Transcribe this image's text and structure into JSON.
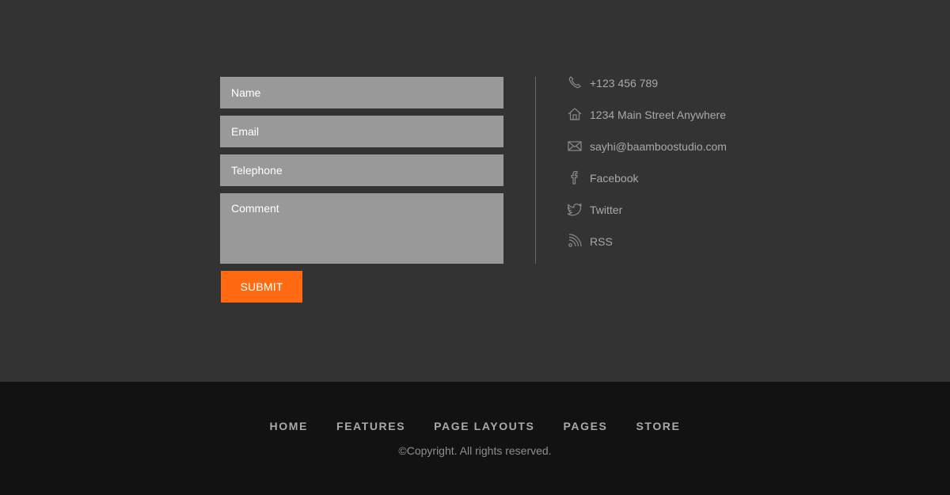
{
  "form": {
    "name_placeholder": "Name",
    "email_placeholder": "Email",
    "telephone_placeholder": "Telephone",
    "comment_placeholder": "Comment",
    "submit_label": "SUBMIT"
  },
  "contact": {
    "items": [
      {
        "icon": "phone-icon",
        "label": "+123 456 789"
      },
      {
        "icon": "home-icon",
        "label": "1234 Main Street Anywhere"
      },
      {
        "icon": "mail-icon",
        "label": "sayhi@baamboostudio.com"
      },
      {
        "icon": "facebook-icon",
        "label": "Facebook"
      },
      {
        "icon": "twitter-icon",
        "label": "Twitter"
      },
      {
        "icon": "rss-icon",
        "label": "RSS"
      }
    ]
  },
  "footer": {
    "nav": [
      "HOME",
      "FEATURES",
      "PAGE LAYOUTS",
      "PAGES",
      "STORE"
    ],
    "copyright": "©Copyright. All rights reserved."
  },
  "colors": {
    "background": "#333333",
    "footer_background": "#121212",
    "field_background": "#999999",
    "accent": "#ff6a13",
    "muted_text": "#a9a9a9"
  }
}
